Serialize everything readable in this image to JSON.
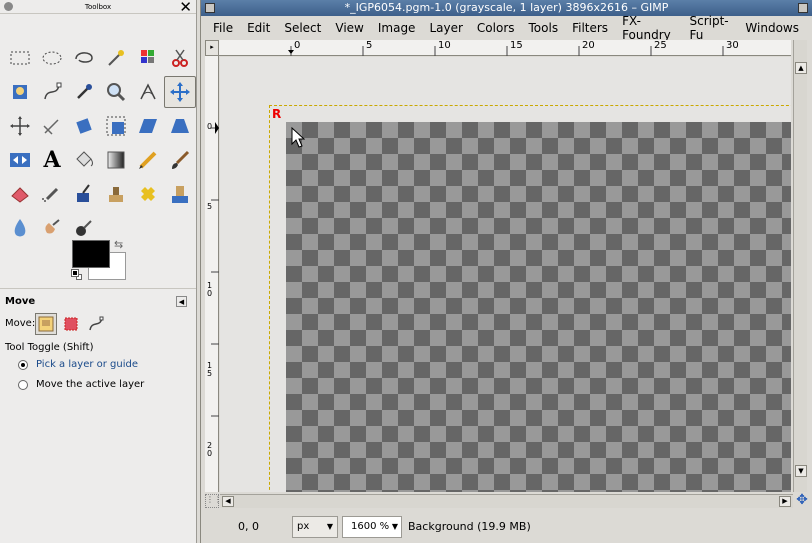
{
  "toolbox": {
    "title": "Toolbox",
    "tool_options": {
      "title": "Move",
      "move_label": "Move:",
      "tool_toggle": "Tool Toggle  (Shift)",
      "radio_options": [
        {
          "label": "Pick a layer or guide",
          "selected": true
        },
        {
          "label": "Move the active layer",
          "selected": false
        }
      ]
    },
    "colors": {
      "foreground": "#000000",
      "background": "#ffffff"
    }
  },
  "image_window": {
    "title": "*_IGP6054.pgm-1.0 (grayscale, 1 layer) 3896x2616 – GIMP",
    "menu": [
      "File",
      "Edit",
      "Select",
      "View",
      "Image",
      "Layer",
      "Colors",
      "Tools",
      "Filters",
      "FX-Foundry",
      "Script-Fu",
      "Windows"
    ],
    "ruler_top_ticks": [
      "0",
      "5",
      "10",
      "15",
      "20",
      "25",
      "30"
    ],
    "ruler_left_ticks": [
      "0",
      "5",
      "10",
      "15",
      "20"
    ],
    "marker": "R",
    "status": {
      "coords": "0, 0",
      "units": "px",
      "zoom": "1600 %",
      "layer_info": "Background (19.9 MB)"
    }
  }
}
